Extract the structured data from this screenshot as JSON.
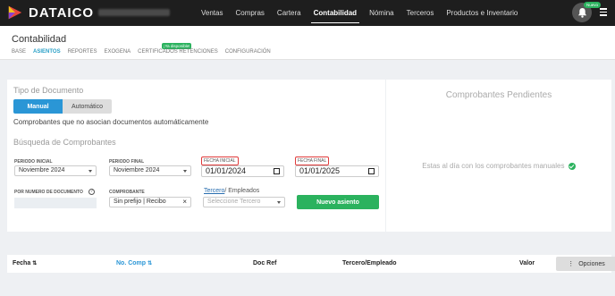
{
  "topbar": {
    "brand": "DATAICO",
    "nav": [
      "Ventas",
      "Compras",
      "Cartera",
      "Contabilidad",
      "Nómina",
      "Terceros",
      "Productos e Inventario"
    ],
    "active_nav": "Contabilidad",
    "notification_badge": "Nuevo"
  },
  "subheader": {
    "title": "Contabilidad",
    "tabs": [
      "BASE",
      "ASIENTOS",
      "REPORTES",
      "EXOGENA",
      "CERTIFICADOS RETENCIONES",
      "CONFIGURACIÓN"
    ],
    "active_tab": "ASIENTOS",
    "certificados_tag": "¡Ya disponible!"
  },
  "form": {
    "doc_type_title": "Tipo de Documento",
    "btn_manual": "Manual",
    "btn_auto": "Automático",
    "helper_text": "Comprobantes que no asocian documentos automáticamente",
    "search_title": "Búsqueda de Comprobantes",
    "periodo_inicial_label": "PERIODO INICIAL",
    "periodo_inicial_value": "Noviembre 2024",
    "periodo_final_label": "PERIODO FINAL",
    "periodo_final_value": "Noviembre 2024",
    "fecha_inicial_label": "FECHA INICIAL",
    "fecha_inicial_value": "01/01/2024",
    "fecha_final_label": "FECHA FINAL",
    "fecha_final_value": "01/01/2025",
    "numero_doc_label": "POR NUMERO DE DOCUMENTO",
    "comprobante_label": "COMPROBANTE",
    "comprobante_value": "Sin prefijo | Recibo",
    "tercero_link": "Tercero",
    "empleados_text": "/ Empleados",
    "tercero_placeholder": "Seleccione Tercero",
    "btn_new": "Nuevo asiento"
  },
  "pending": {
    "title": "Comprobantes Pendientes",
    "message": "Estas al día con los comprobantes manuales"
  },
  "table": {
    "columns": [
      "Fecha",
      "No. Comp",
      "Doc Ref",
      "Tercero/Empleado",
      "Valor"
    ],
    "options_label": "Opciones"
  },
  "colors": {
    "accent": "#2a96d6",
    "success": "#2bb25e",
    "topbar": "#1e1e1e"
  }
}
